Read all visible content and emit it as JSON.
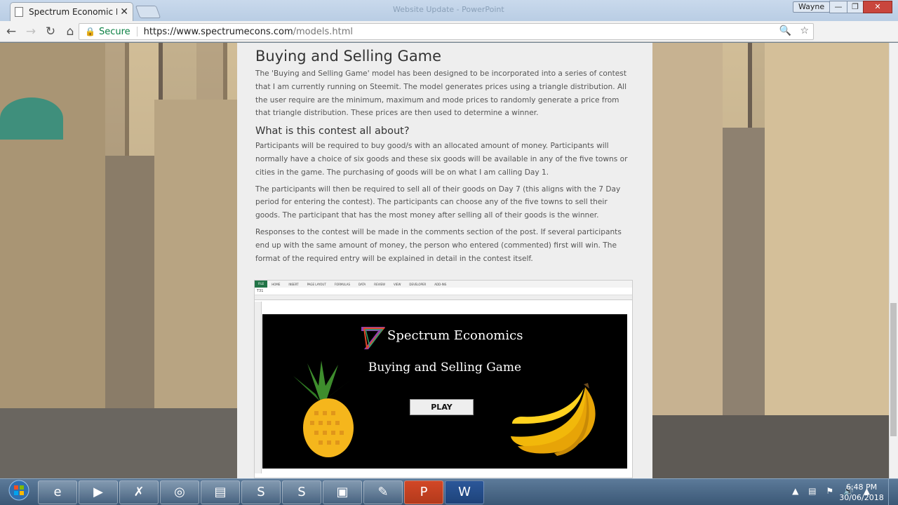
{
  "browser": {
    "tab_title": "Spectrum Economic Mod",
    "tab_close": "✕",
    "window_caption": "Website Update - PowerPoint",
    "user": "Wayne",
    "minimize": "—",
    "maximize": "❐",
    "close": "✕",
    "secure_label": "Secure",
    "url_host": "https://www.spectrumecons.com",
    "url_path": "/models.html"
  },
  "article": {
    "title": "Buying and Selling Game",
    "intro": "The 'Buying and Selling Game' model has been designed to be incorporated into a series of contest that I am currently running on Steemit. The model generates prices using a triangle distribution. All the user require are the minimum, maximum and mode prices to randomly generate a price from that triangle distribution. These prices are then used to determine a winner.",
    "section_heading": "What is this contest all about?",
    "paragraphs": [
      "Participants will be required to buy good/s with an allocated amount of money. Participants will normally have a choice of six goods and these six goods will be available in any of the five towns or cities in the game. The purchasing of goods will be on what I am calling Day 1.",
      "The participants will then be required to sell all of their goods on Day 7 (this aligns with the 7 Day period for entering the contest). The participants can choose any of the five towns to sell their goods. The participant that has the most money after selling all of their goods is the winner.",
      "Responses to the contest will be made in the comments section of the post. If several participants end up with the same amount of money, the person who entered (commented) first will win. The format of the required entry will be explained in detail in the contest itself."
    ]
  },
  "excel": {
    "tabs": [
      "FILE",
      "HOME",
      "INSERT",
      "PAGE LAYOUT",
      "FORMULAS",
      "DATA",
      "REVIEW",
      "VIEW",
      "DEVELOPER",
      "ADD-INS"
    ],
    "cell_ref": "T31",
    "game_title": "Spectrum Economics",
    "game_subtitle": "Buying and Selling Game",
    "play_label": "PLAY"
  },
  "taskbar": {
    "time": "6:48 PM",
    "date": "30/06/2018"
  }
}
